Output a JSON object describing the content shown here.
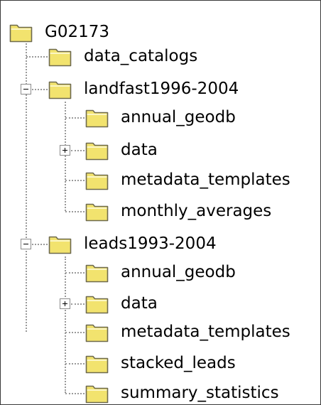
{
  "tree": {
    "root": {
      "label": "G02173",
      "icon": "folder-icon",
      "expanded": true
    },
    "children": [
      {
        "label": "data_catalogs",
        "icon": "folder-icon"
      },
      {
        "label": "landfast1996-2004",
        "icon": "folder-icon",
        "expanded": true,
        "children": [
          {
            "label": "annual_geodb",
            "icon": "folder-icon"
          },
          {
            "label": "data",
            "icon": "folder-icon",
            "expanded": false
          },
          {
            "label": "metadata_templates",
            "icon": "folder-icon"
          },
          {
            "label": "monthly_averages",
            "icon": "folder-icon"
          }
        ]
      },
      {
        "label": "leads1993-2004",
        "icon": "folder-icon",
        "expanded": true,
        "children": [
          {
            "label": "annual_geodb",
            "icon": "folder-icon"
          },
          {
            "label": "data",
            "icon": "folder-icon",
            "expanded": false
          },
          {
            "label": "metadata_templates",
            "icon": "folder-icon"
          },
          {
            "label": "stacked_leads",
            "icon": "folder-icon"
          },
          {
            "label": "summary_statistics",
            "icon": "folder-icon"
          }
        ]
      }
    ]
  },
  "colors": {
    "folder_fill": "#f2e36e",
    "folder_outline": "#6e6a4e",
    "connector_line": "#9a9a9a",
    "border": "#3a3a3a"
  }
}
